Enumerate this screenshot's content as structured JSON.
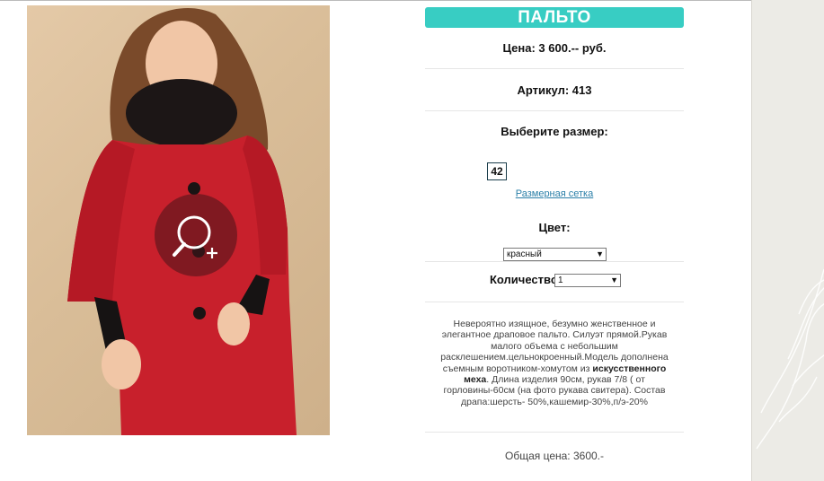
{
  "product": {
    "title": "ПАЛЬТО",
    "price": "Цена: 3 600.-- руб.",
    "article": "Артикул: 413",
    "size_label": "Выберите размер:",
    "size_value": "42",
    "size_chart_link": "Размерная сетка",
    "color_label": "Цвет:",
    "color_selected": "красный",
    "quantity_label": "Количество:",
    "quantity_selected": "1",
    "description_part1": "Невероятно изящное, безумно женственное и элегантное драповое пальто. Силуэт прямой.Рукав малого объема с небольшим расклешением.цельнокроенный.Модель дополнена съемным воротником-хомутом из",
    "description_bold": "искусственного меха",
    "description_part2": ". Длина изделия 90см, рукав 7/8 ( от горловины-60см (на фото рукава свитера). Состав драпа:шерсть- 50%,кашемир-30%,п/э-20%",
    "total": "Общая цена: 3600.-"
  },
  "colors": {
    "accent": "#38cdc3",
    "link": "#2a7fa8",
    "coat": "#c8202c"
  },
  "icons": {
    "zoom": "zoom-in-icon",
    "dropdown": "chevron-down-icon"
  }
}
